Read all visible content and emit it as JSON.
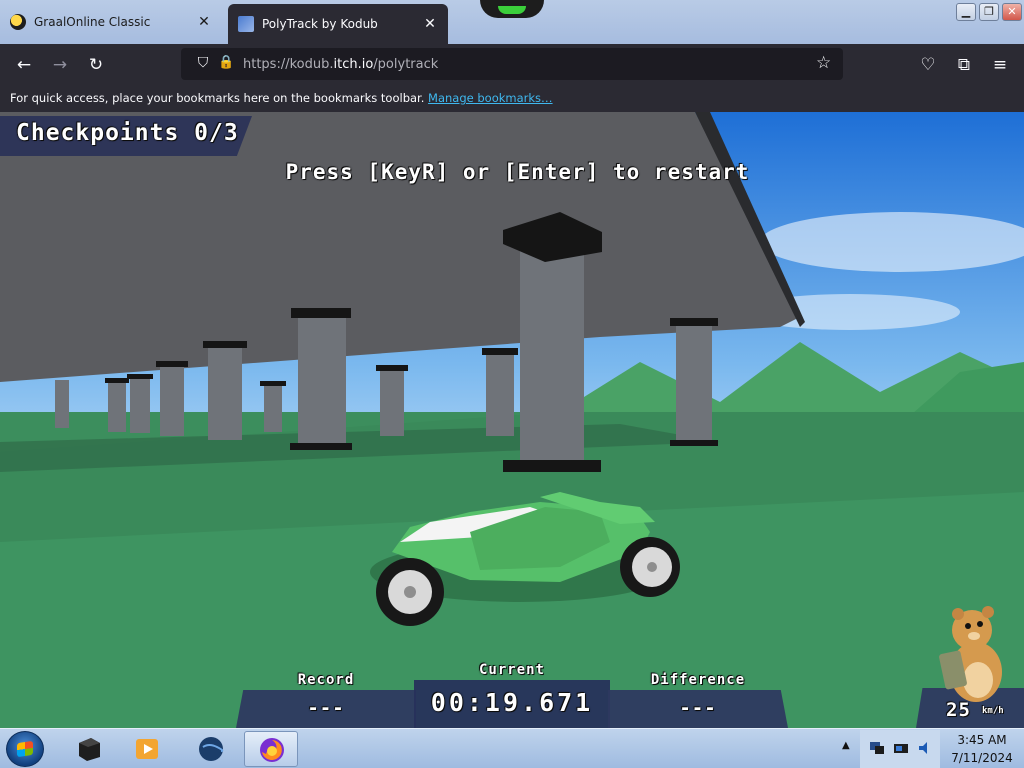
{
  "browser": {
    "tabs": [
      {
        "label": "GraalOnline Classic",
        "close": "✕"
      },
      {
        "label": "PolyTrack by Kodub",
        "close": "✕"
      }
    ],
    "window_buttons": {
      "minimize": "▁",
      "maximize": "❐",
      "close": "✕"
    },
    "url_prefix": "https://kodub.",
    "url_host": "itch.io",
    "url_path": "/polytrack",
    "bookmarks_text": "For quick access, place your bookmarks here on the bookmarks toolbar.",
    "bookmarks_link": "Manage bookmarks…",
    "icons": {
      "back": "←",
      "forward": "→",
      "reload": "↻",
      "shield": "⛉",
      "lock": "🔒",
      "star": "☆",
      "pocket": "♡",
      "extensions": "⧉",
      "menu": "≡"
    }
  },
  "game": {
    "checkpoints": "Checkpoints 0/3",
    "restart_message": "Press [KeyR] or [Enter] to restart",
    "record_label": "Record",
    "record_value": "---",
    "current_label": "Current",
    "current_value": "00:19.671",
    "difference_label": "Difference",
    "difference_value": "---",
    "speed_value": "25",
    "speed_unit": "km/h"
  },
  "taskbar": {
    "time": "3:45 AM",
    "date": "7/11/2024",
    "tray_up": "▲"
  }
}
